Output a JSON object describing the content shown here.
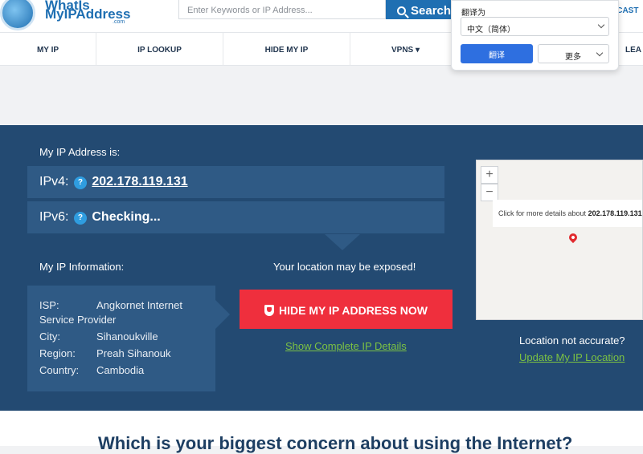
{
  "header": {
    "logo_line1": "WhatIs",
    "logo_line2": "MyIPAddress",
    "logo_com": ".com",
    "search_placeholder": "Enter Keywords or IP Address...",
    "search_label": "Search",
    "podcast_label": "DCAST"
  },
  "nav": {
    "items": [
      "MY IP",
      "IP LOOKUP",
      "HIDE MY IP",
      "VPNS ▾",
      "LEA"
    ]
  },
  "translate_popup": {
    "label": "翻译为",
    "language": "中文（简体）",
    "translate_button": "翻译",
    "more_button": "更多"
  },
  "hero": {
    "my_ip_label": "My IP Address is:",
    "ipv4_label": "IPv4:",
    "ipv4_value": "202.178.119.131",
    "ipv6_label": "IPv6:",
    "ipv6_value": "Checking...",
    "help_icon_text": "?",
    "info_label": "My IP Information:",
    "exposed_text": "Your location may be exposed!",
    "hide_button": "HIDE MY IP ADDRESS NOW",
    "details_link": "Show Complete IP Details",
    "not_accurate": "Location not accurate?",
    "update_link": "Update My IP Location",
    "info": {
      "isp_label": "ISP:",
      "isp_value": "Angkornet Internet",
      "isp_value2": "Service Provider",
      "city_label": "City:",
      "city_value": "Sihanoukville",
      "region_label": "Region:",
      "region_value": "Preah Sihanouk",
      "country_label": "Country:",
      "country_value": "Cambodia"
    }
  },
  "map": {
    "zoom_in": "+",
    "zoom_out": "−",
    "popup_text": "Click for more details about",
    "popup_ip": "202.178.119.131"
  },
  "bottom": {
    "heading": "Which is your biggest concern about using the Internet?"
  },
  "colors": {
    "hero_bg": "#234a72",
    "panel_bg": "#2f5a85",
    "accent_red": "#ef2f3d",
    "link_green": "#7cc243",
    "brand_blue": "#1f6fb2"
  }
}
